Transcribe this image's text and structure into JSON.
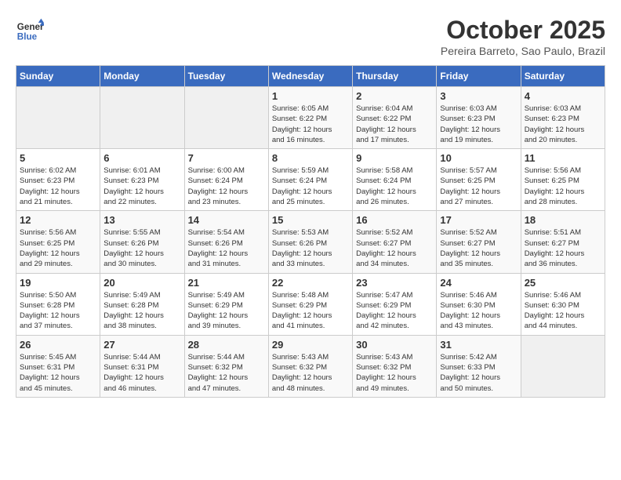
{
  "header": {
    "logo_general": "General",
    "logo_blue": "Blue",
    "month_title": "October 2025",
    "location": "Pereira Barreto, Sao Paulo, Brazil"
  },
  "weekdays": [
    "Sunday",
    "Monday",
    "Tuesday",
    "Wednesday",
    "Thursday",
    "Friday",
    "Saturday"
  ],
  "weeks": [
    [
      {
        "day": "",
        "info": ""
      },
      {
        "day": "",
        "info": ""
      },
      {
        "day": "",
        "info": ""
      },
      {
        "day": "1",
        "info": "Sunrise: 6:05 AM\nSunset: 6:22 PM\nDaylight: 12 hours\nand 16 minutes."
      },
      {
        "day": "2",
        "info": "Sunrise: 6:04 AM\nSunset: 6:22 PM\nDaylight: 12 hours\nand 17 minutes."
      },
      {
        "day": "3",
        "info": "Sunrise: 6:03 AM\nSunset: 6:23 PM\nDaylight: 12 hours\nand 19 minutes."
      },
      {
        "day": "4",
        "info": "Sunrise: 6:03 AM\nSunset: 6:23 PM\nDaylight: 12 hours\nand 20 minutes."
      }
    ],
    [
      {
        "day": "5",
        "info": "Sunrise: 6:02 AM\nSunset: 6:23 PM\nDaylight: 12 hours\nand 21 minutes."
      },
      {
        "day": "6",
        "info": "Sunrise: 6:01 AM\nSunset: 6:23 PM\nDaylight: 12 hours\nand 22 minutes."
      },
      {
        "day": "7",
        "info": "Sunrise: 6:00 AM\nSunset: 6:24 PM\nDaylight: 12 hours\nand 23 minutes."
      },
      {
        "day": "8",
        "info": "Sunrise: 5:59 AM\nSunset: 6:24 PM\nDaylight: 12 hours\nand 25 minutes."
      },
      {
        "day": "9",
        "info": "Sunrise: 5:58 AM\nSunset: 6:24 PM\nDaylight: 12 hours\nand 26 minutes."
      },
      {
        "day": "10",
        "info": "Sunrise: 5:57 AM\nSunset: 6:25 PM\nDaylight: 12 hours\nand 27 minutes."
      },
      {
        "day": "11",
        "info": "Sunrise: 5:56 AM\nSunset: 6:25 PM\nDaylight: 12 hours\nand 28 minutes."
      }
    ],
    [
      {
        "day": "12",
        "info": "Sunrise: 5:56 AM\nSunset: 6:25 PM\nDaylight: 12 hours\nand 29 minutes."
      },
      {
        "day": "13",
        "info": "Sunrise: 5:55 AM\nSunset: 6:26 PM\nDaylight: 12 hours\nand 30 minutes."
      },
      {
        "day": "14",
        "info": "Sunrise: 5:54 AM\nSunset: 6:26 PM\nDaylight: 12 hours\nand 31 minutes."
      },
      {
        "day": "15",
        "info": "Sunrise: 5:53 AM\nSunset: 6:26 PM\nDaylight: 12 hours\nand 33 minutes."
      },
      {
        "day": "16",
        "info": "Sunrise: 5:52 AM\nSunset: 6:27 PM\nDaylight: 12 hours\nand 34 minutes."
      },
      {
        "day": "17",
        "info": "Sunrise: 5:52 AM\nSunset: 6:27 PM\nDaylight: 12 hours\nand 35 minutes."
      },
      {
        "day": "18",
        "info": "Sunrise: 5:51 AM\nSunset: 6:27 PM\nDaylight: 12 hours\nand 36 minutes."
      }
    ],
    [
      {
        "day": "19",
        "info": "Sunrise: 5:50 AM\nSunset: 6:28 PM\nDaylight: 12 hours\nand 37 minutes."
      },
      {
        "day": "20",
        "info": "Sunrise: 5:49 AM\nSunset: 6:28 PM\nDaylight: 12 hours\nand 38 minutes."
      },
      {
        "day": "21",
        "info": "Sunrise: 5:49 AM\nSunset: 6:29 PM\nDaylight: 12 hours\nand 39 minutes."
      },
      {
        "day": "22",
        "info": "Sunrise: 5:48 AM\nSunset: 6:29 PM\nDaylight: 12 hours\nand 41 minutes."
      },
      {
        "day": "23",
        "info": "Sunrise: 5:47 AM\nSunset: 6:29 PM\nDaylight: 12 hours\nand 42 minutes."
      },
      {
        "day": "24",
        "info": "Sunrise: 5:46 AM\nSunset: 6:30 PM\nDaylight: 12 hours\nand 43 minutes."
      },
      {
        "day": "25",
        "info": "Sunrise: 5:46 AM\nSunset: 6:30 PM\nDaylight: 12 hours\nand 44 minutes."
      }
    ],
    [
      {
        "day": "26",
        "info": "Sunrise: 5:45 AM\nSunset: 6:31 PM\nDaylight: 12 hours\nand 45 minutes."
      },
      {
        "day": "27",
        "info": "Sunrise: 5:44 AM\nSunset: 6:31 PM\nDaylight: 12 hours\nand 46 minutes."
      },
      {
        "day": "28",
        "info": "Sunrise: 5:44 AM\nSunset: 6:32 PM\nDaylight: 12 hours\nand 47 minutes."
      },
      {
        "day": "29",
        "info": "Sunrise: 5:43 AM\nSunset: 6:32 PM\nDaylight: 12 hours\nand 48 minutes."
      },
      {
        "day": "30",
        "info": "Sunrise: 5:43 AM\nSunset: 6:32 PM\nDaylight: 12 hours\nand 49 minutes."
      },
      {
        "day": "31",
        "info": "Sunrise: 5:42 AM\nSunset: 6:33 PM\nDaylight: 12 hours\nand 50 minutes."
      },
      {
        "day": "",
        "info": ""
      }
    ]
  ]
}
